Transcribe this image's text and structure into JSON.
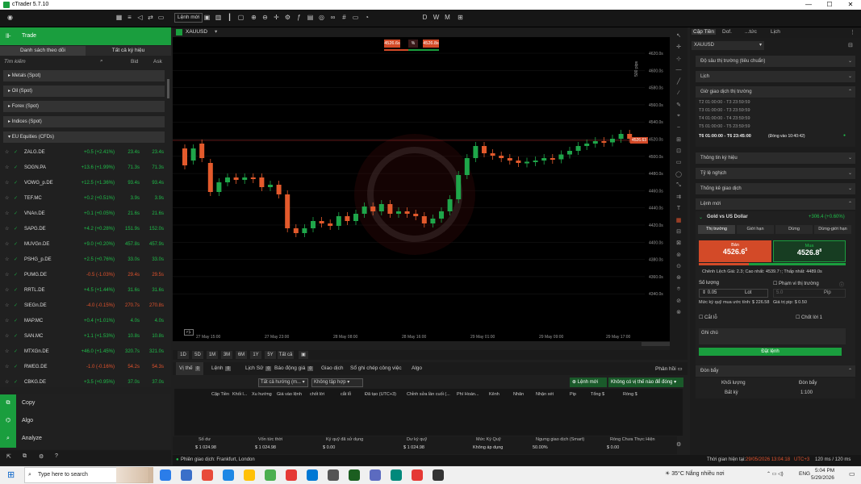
{
  "app": {
    "title": "cTrader 5.7.10"
  },
  "window_controls": {
    "minimize": "—",
    "maximize": "☐",
    "close": "✕"
  },
  "toolbar": {
    "new_order": "Lệnh mới",
    "right_letters": [
      "D",
      "W",
      "M"
    ]
  },
  "left": {
    "trade_label": "Trade",
    "tab_watchlist": "Danh sách theo dõi",
    "tab_all": "Tất cả ký hiệu",
    "search_placeholder": "Tìm kiếm",
    "col_bid": "Bid",
    "col_ask": "Ask",
    "categories": [
      "Metals (Spot)",
      "Oil (Spot)",
      "Forex (Spot)",
      "Indices (Spot)",
      "EU Equities (CFDs)"
    ],
    "symbols": [
      {
        "sym": "ZALG.DE",
        "chg": "+0.5 (+2.41%)",
        "bid": "23.4s",
        "ask": "23.4s",
        "up": true
      },
      {
        "sym": "SOGN.PA",
        "chg": "+13.6 (+1.99%)",
        "bid": "71.3s",
        "ask": "71.3s",
        "up": true
      },
      {
        "sym": "VOWG_p.DE",
        "chg": "+12.5 (+1.36%)",
        "bid": "93.4s",
        "ask": "93.4s",
        "up": true
      },
      {
        "sym": "TEF.MC",
        "chg": "+0.2 (+0.51%)",
        "bid": "3.9s",
        "ask": "3.9s",
        "up": true
      },
      {
        "sym": "VNAn.DE",
        "chg": "+0.1 (+0.05%)",
        "bid": "21.6s",
        "ask": "21.6s",
        "up": true
      },
      {
        "sym": "SAPG.DE",
        "chg": "+4.2 (+0.28%)",
        "bid": "151.9s",
        "ask": "152.0s",
        "up": true
      },
      {
        "sym": "MUVGn.DE",
        "chg": "+9.0 (+0.20%)",
        "bid": "457.8s",
        "ask": "457.9s",
        "up": true
      },
      {
        "sym": "PSHG_p.DE",
        "chg": "+2.5 (+0.76%)",
        "bid": "33.0s",
        "ask": "33.0s",
        "up": true
      },
      {
        "sym": "PUMG.DE",
        "chg": "-0.5 (-1.03%)",
        "bid": "29.4s",
        "ask": "29.5s",
        "up": false
      },
      {
        "sym": "RRTL.DE",
        "chg": "+4.5 (+1.44%)",
        "bid": "31.6s",
        "ask": "31.6s",
        "up": true
      },
      {
        "sym": "SIEGn.DE",
        "chg": "-4.0 (-0.15%)",
        "bid": "270.7s",
        "ask": "270.8s",
        "up": false
      },
      {
        "sym": "MAP.MC",
        "chg": "+0.4 (+1.01%)",
        "bid": "4.0s",
        "ask": "4.0s",
        "up": true
      },
      {
        "sym": "SAN.MC",
        "chg": "+1.1 (+1.53%)",
        "bid": "10.8s",
        "ask": "10.8s",
        "up": true
      },
      {
        "sym": "MTXGn.DE",
        "chg": "+46.0 (+1.45%)",
        "bid": "320.7s",
        "ask": "321.0s",
        "up": true
      },
      {
        "sym": "RWEG.DE",
        "chg": "-1.0 (-0.16%)",
        "bid": "54.2s",
        "ask": "54.3s",
        "up": false
      },
      {
        "sym": "CBKG.DE",
        "chg": "+3.5 (+0.95%)",
        "bid": "37.0s",
        "ask": "37.0s",
        "up": true
      }
    ],
    "bottom": [
      "Copy",
      "Algo",
      "Analyze"
    ]
  },
  "chart": {
    "symbol": "XAUUSD",
    "sell_box": "4526.6s",
    "buy_box": "4526.8s",
    "price_marker": "4526.63",
    "pip_label": "500 pips",
    "timeframes": [
      "1D",
      "5D",
      "1M",
      "3M",
      "6M",
      "1Y",
      "5Y",
      "Tất cả"
    ],
    "y_ticks": [
      "4620.0s",
      "4600.0s",
      "4580.0s",
      "4560.0s",
      "4540.0s",
      "4520.0s",
      "4500.0s",
      "4480.0s",
      "4460.0s",
      "4440.0s",
      "4420.0s",
      "4400.0s",
      "4380.0s",
      "4360.0s",
      "4340.0s"
    ],
    "x_ticks": [
      "27 May 15:00",
      "27 May 23:00",
      "28 May 08:00",
      "28 May 16:00",
      "29 May 01:00",
      "29 May 09:00",
      "29 May 17:00"
    ],
    "candles": [
      [
        0,
        1,
        0.3
      ],
      [
        1,
        0.5,
        1.0
      ],
      [
        2,
        1.2,
        0.6
      ],
      [
        3,
        0.4,
        -0.8
      ],
      [
        4,
        -0.8,
        -0.4
      ],
      [
        5,
        -0.4,
        -0.2
      ],
      [
        6,
        -0.2,
        -0.3
      ],
      [
        7,
        -0.3,
        -0.2
      ],
      [
        8,
        -0.2,
        -0.2
      ],
      [
        9,
        -0.2,
        -0.6
      ],
      [
        10,
        -0.6,
        -0.5
      ],
      [
        11,
        -0.5,
        -0.9
      ],
      [
        12,
        -0.9,
        -2.3
      ],
      [
        13,
        -2.3,
        -2.5
      ],
      [
        14,
        -2.5,
        -2.3
      ],
      [
        15,
        -2.3,
        -2.0
      ],
      [
        16,
        -2.0,
        -2.1
      ],
      [
        17,
        -2.1,
        -2.2
      ],
      [
        18,
        -2.2,
        -1.8
      ],
      [
        19,
        -1.8,
        -2.0
      ],
      [
        20,
        -2.0,
        -1.7
      ],
      [
        21,
        -1.7,
        -1.4
      ],
      [
        22,
        -1.4,
        -1.6
      ],
      [
        23,
        -1.6,
        -1.3
      ],
      [
        24,
        -1.3,
        -1.7
      ],
      [
        25,
        -1.7,
        -1.6
      ],
      [
        26,
        -1.6,
        -1.7
      ],
      [
        27,
        -1.7,
        -1.8
      ],
      [
        28,
        -1.8,
        -2.1
      ],
      [
        29,
        -2.1,
        -1.9
      ],
      [
        30,
        -1.9,
        -1.6
      ],
      [
        31,
        -1.6,
        -1.1
      ],
      [
        32,
        -1.1,
        -0.1
      ],
      [
        33,
        -0.1,
        0.6
      ],
      [
        34,
        0.6,
        1.1
      ],
      [
        35,
        1.1,
        0.8
      ],
      [
        36,
        0.8,
        0.7
      ],
      [
        37,
        0.7,
        0.6
      ],
      [
        38,
        0.6,
        0.5
      ],
      [
        39,
        0.5,
        0.4
      ],
      [
        40,
        0.4,
        0.45
      ],
      [
        41,
        0.45,
        0.5
      ],
      [
        42,
        0.5,
        0.6
      ],
      [
        43,
        0.6,
        0.55
      ],
      [
        44,
        0.55,
        0.75
      ],
      [
        45,
        0.75,
        0.9
      ],
      [
        46,
        0.9,
        1.1
      ],
      [
        47,
        1.1,
        1.2
      ],
      [
        48,
        1.2,
        1.3
      ],
      [
        49,
        1.3,
        1.25
      ],
      [
        50,
        1.25,
        1.4
      ],
      [
        51,
        1.4,
        1.6
      ],
      [
        52,
        1.6,
        1.4
      ]
    ]
  },
  "bottom": {
    "tabs": [
      "Vị thế",
      "Lệnh",
      "Lịch Sử",
      "Báo động giá",
      "Giao dịch",
      "Sổ ghi chép công việc",
      "Algo"
    ],
    "tab_counts": [
      "0",
      "0",
      "0"
    ],
    "feedback": "Phản hồi",
    "filter1": "Tất cả hướng (m...",
    "filter2": "Không tập hợp",
    "new_order": "Lệnh mới",
    "close_btn": "Không có vị thế nào để đóng",
    "columns": [
      "Cặp Tiền",
      "Khối l...",
      "Xu hướng",
      "Giá vào lệnh",
      "chốt lời",
      "cắt lỗ",
      "Đã tạo (UTC+3)",
      "Chỉnh sửa lần cuối (...",
      "Phí Hoán...",
      "Kênh",
      "Nhãn",
      "Nhận xét",
      "Pip",
      "Tổng $",
      "Ròng $"
    ],
    "summary_labels": [
      "Số dư",
      "Vốn tức thời",
      "Ký quỹ đã sử dụng",
      "Dư ký quỹ",
      "Mức Ký Quỹ",
      "Ngưng giao dịch (Smart)",
      "Ròng Chưa Thực Hiện"
    ],
    "summary_values": [
      "$ 1 024.98",
      "$ 1 024.98",
      "$ 0.00",
      "$ 1 024.98",
      "Không áp dụng",
      "50.00%",
      "$ 0.00"
    ]
  },
  "status": {
    "session": "Phiên giao dịch: Frankfurt, London",
    "server_time_label": "Thời gian hiện tại:",
    "server_time": "29/05/2026 13:04:18",
    "tz": "UTC+3",
    "latency": "120 ms / 120 ms"
  },
  "right": {
    "tabs": [
      "Cặp Tiền",
      "Dof.",
      "...tức",
      "Lịch"
    ],
    "symbol": "XAUUSD",
    "sections": [
      "Độ sâu thị trường (tiêu chuẩn)",
      "Lịch",
      "Giờ giao dịch thị trường"
    ],
    "hours": [
      "T2 01:00:00 - T3 23:59:59",
      "T3 01:00:00 - T3 23:59:59",
      "T4 01:00:00 - T4 23:59:59",
      "T5 01:00:00 - T5 23:59:59"
    ],
    "hours_active": "T6 01:00:00 - T6 23:45:00",
    "hours_close": "(Đóng vào 10:40:42)",
    "sections2": [
      "Thông tin ký hiệu",
      "Tỷ lệ nghịch",
      "Thống kê giao dịch",
      "Lệnh mới"
    ],
    "instrument": "Gold vs US Dollar",
    "instrument_chg": "+306.4 (+0.60%)",
    "order_types": [
      "Thị trường",
      "Giới hạn",
      "Dừng",
      "Dừng-giới hạn"
    ],
    "sell_label": "Bán",
    "sell_price": "4526.6",
    "sell_sup": "5",
    "buy_label": "Mua",
    "buy_price": "4526.8",
    "buy_sup": "8",
    "spread": "Chênh Lệch Giá: 2.3; Cao nhất: 4539.7↑; Thấp nhất: 4489.0s",
    "qty_label": "Số lượng",
    "range_label": "Phạm vi thị trường",
    "qty": "0.05",
    "lot": "Lot",
    "range": "5.0",
    "pip": "Pip",
    "margin_est": "Mức ký quỹ mua ước tính: $ 226.58",
    "pip_val": "Giá trị pip: $ 0.50",
    "sl": "Cắt lỗ",
    "tp": "Chốt lời 1",
    "note": "Ghi chú",
    "place": "Đặt lệnh",
    "leverage_section": "Đòn bẩy",
    "lev_col1": "Khối lượng",
    "lev_col2": "Đòn bẩy",
    "lev_v1": "Bất kỳ",
    "lev_v2": "1:100"
  },
  "taskbar": {
    "search": "Type here to search",
    "weather": "35°C  Nắng nhiều nơi",
    "lang": "ENG",
    "time": "5:04 PM",
    "date": "5/29/2026"
  },
  "colors": {
    "green": "#1a9e3e",
    "red": "#e2532d",
    "bull": "#1fa64a",
    "bear": "#e35a2c"
  }
}
